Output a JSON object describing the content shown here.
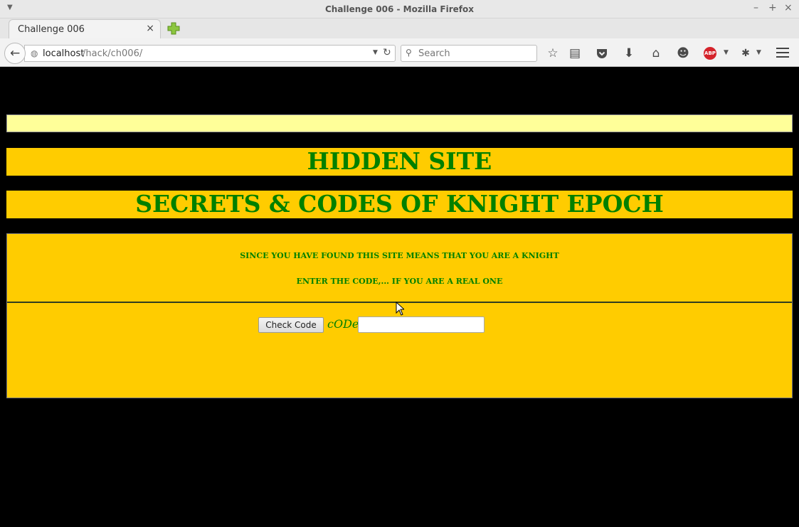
{
  "window": {
    "title": "Challenge 006 - Mozilla Firefox",
    "controls": [
      "–",
      "+",
      "×"
    ]
  },
  "tabs": [
    {
      "label": "Challenge 006",
      "close": "×"
    }
  ],
  "navbar": {
    "url_host": "localhost",
    "url_path": "/hack/ch006/",
    "search_placeholder": "Search",
    "abp_label": "ABP"
  },
  "page": {
    "heading1": "HIDDEN SITE",
    "heading2": "SECRETS & CODES OF KNIGHT EPOCH",
    "message1": "SINCE YOU HAVE FOUND THIS SITE MEANS THAT YOU ARE A KNIGHT",
    "message2": "ENTER THE CODE,... IF YOU ARE A REAL ONE",
    "check_button": "Check Code",
    "code_label": "cODe",
    "code_value": ""
  },
  "colors": {
    "banner_bg": "#ffcc00",
    "banner_text": "#008000",
    "top_bar": "#ffff99",
    "page_bg": "#000000"
  }
}
